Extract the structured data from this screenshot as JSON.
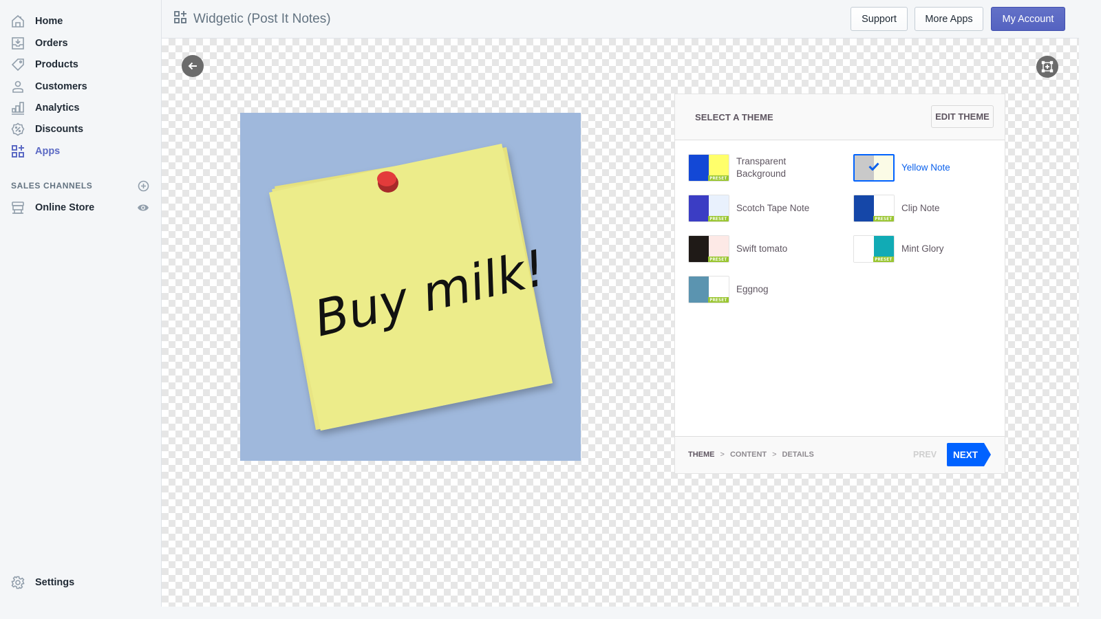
{
  "sidebar": {
    "items": [
      {
        "id": "home",
        "label": "Home",
        "icon": "home-icon"
      },
      {
        "id": "orders",
        "label": "Orders",
        "icon": "orders-icon"
      },
      {
        "id": "products",
        "label": "Products",
        "icon": "tag-icon"
      },
      {
        "id": "customers",
        "label": "Customers",
        "icon": "person-icon"
      },
      {
        "id": "analytics",
        "label": "Analytics",
        "icon": "bar-chart-icon"
      },
      {
        "id": "discounts",
        "label": "Discounts",
        "icon": "discount-badge-icon"
      },
      {
        "id": "apps",
        "label": "Apps",
        "icon": "apps-grid-icon",
        "active": true
      }
    ],
    "sales_channels_title": "SALES CHANNELS",
    "channels": [
      {
        "label": "Online Store",
        "icon": "store-icon"
      }
    ],
    "settings_label": "Settings"
  },
  "topbar": {
    "app_title": "Widgetic (Post It Notes)",
    "support_label": "Support",
    "more_apps_label": "More Apps",
    "my_account_label": "My Account"
  },
  "preview": {
    "note_text": "Buy milk!"
  },
  "theme_panel": {
    "title": "SELECT A THEME",
    "edit_label": "EDIT THEME",
    "preset_badge": "PRESET",
    "themes": [
      {
        "name": "Transparent Background",
        "left": "#1348d6",
        "right": "#ffff6b",
        "preset": true,
        "selected": false
      },
      {
        "name": "Yellow Note",
        "left": "#c9c9c9",
        "right": "#fbfbe6",
        "preset": false,
        "selected": true
      },
      {
        "name": "Scotch Tape Note",
        "left": "#3b3dc4",
        "right": "#e9f1fd",
        "preset": true,
        "selected": false
      },
      {
        "name": "Clip Note",
        "left": "#1547a8",
        "right": "#ffffff",
        "preset": true,
        "selected": false
      },
      {
        "name": "Swift tomato",
        "left": "#1f1a17",
        "right": "#fde9e6",
        "preset": true,
        "selected": false
      },
      {
        "name": "Mint Glory",
        "left": "#ffffff",
        "right": "#11abb5",
        "preset": true,
        "selected": false
      },
      {
        "name": "Eggnog",
        "left": "#5b94b0",
        "right": "#ffffff",
        "preset": true,
        "selected": false
      }
    ],
    "breadcrumb": [
      "THEME",
      "CONTENT",
      "DETAILS"
    ],
    "breadcrumb_current": 0,
    "prev_label": "PREV",
    "next_label": "NEXT"
  },
  "colors": {
    "accent": "#5c6ac4",
    "next_blue": "#0062ff",
    "preset_green": "#9ac631"
  }
}
